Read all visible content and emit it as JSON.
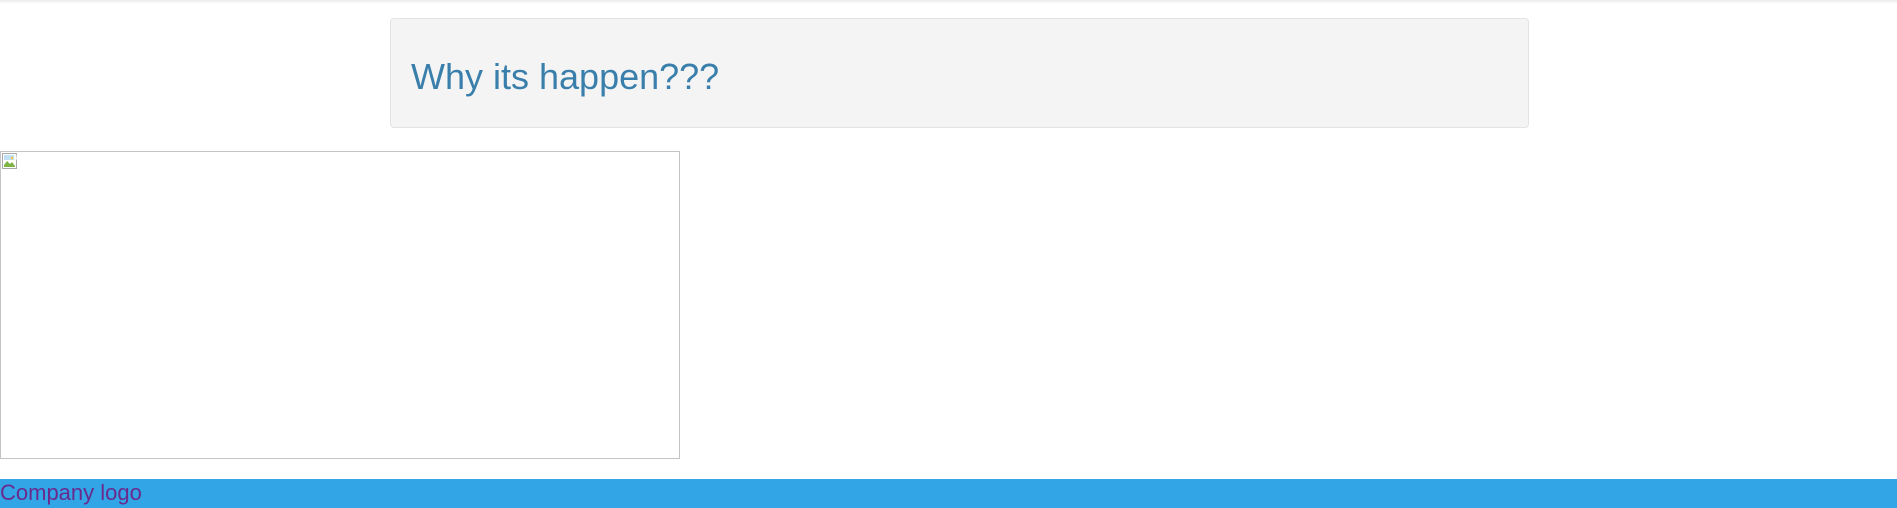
{
  "panel": {
    "title": "Why its happen???"
  },
  "image": {
    "state": "broken",
    "icon": "broken-image-icon"
  },
  "footer": {
    "logo_text": "Company logo"
  },
  "colors": {
    "title": "#3a7fab",
    "panel_background": "#f4f4f4",
    "footer_background": "#32a5e7",
    "logo_text": "#6a2a8c"
  }
}
